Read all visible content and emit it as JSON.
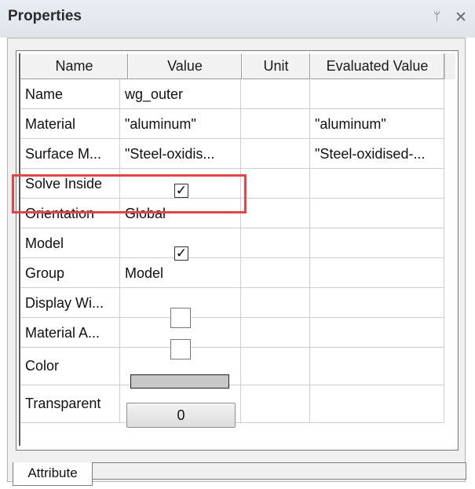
{
  "panel": {
    "title": "Properties",
    "pin_glyph": "ᛘ",
    "close_glyph": "✕"
  },
  "table": {
    "columns": [
      "Name",
      "Value",
      "Unit",
      "Evaluated Value"
    ],
    "rows": [
      {
        "name": "Name",
        "value": "wg_outer",
        "unit": "",
        "evaluated": ""
      },
      {
        "name": "Material",
        "value": "\"aluminum\"",
        "unit": "",
        "evaluated": "\"aluminum\""
      },
      {
        "name": "Surface M...",
        "value": "\"Steel-oxidis...",
        "unit": "",
        "evaluated": "\"Steel-oxidised-..."
      },
      {
        "name": "Solve Inside",
        "value_checked": true,
        "unit": "",
        "evaluated": ""
      },
      {
        "name": "Orientation",
        "value": "Global",
        "unit": "",
        "evaluated": ""
      },
      {
        "name": "Model",
        "value_checked": true,
        "unit": "",
        "evaluated": ""
      },
      {
        "name": "Group",
        "value": "Model",
        "unit": "",
        "evaluated": ""
      },
      {
        "name": "Display Wi...",
        "value_checked": false,
        "unit": "",
        "evaluated": ""
      },
      {
        "name": "Material A...",
        "value_checked": false,
        "unit": "",
        "evaluated": ""
      },
      {
        "name": "Color",
        "value_color": "#c8c8c8",
        "unit": "",
        "evaluated": ""
      },
      {
        "name": "Transparent",
        "value": "0",
        "unit": "",
        "evaluated": ""
      }
    ]
  },
  "checkmark_glyph": "✓",
  "tabs": {
    "active": "Attribute"
  },
  "colors": {
    "highlight": "#e0474a"
  }
}
